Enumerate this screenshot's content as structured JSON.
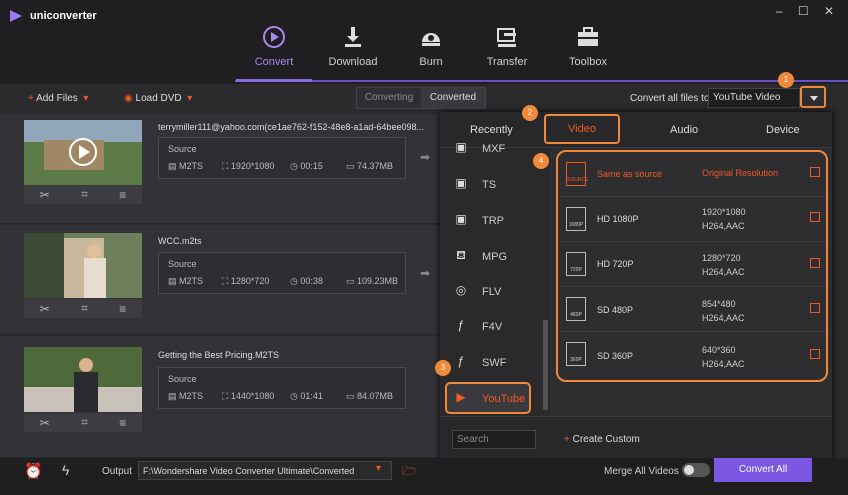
{
  "app": {
    "title": "uniconverter",
    "window_controls": "‒ ☐ ✕"
  },
  "nav": {
    "items": [
      {
        "label": "Convert",
        "icon": "convert-icon"
      },
      {
        "label": "Download",
        "icon": "download-icon"
      },
      {
        "label": "Burn",
        "icon": "burn-icon"
      },
      {
        "label": "Transfer",
        "icon": "transfer-icon"
      },
      {
        "label": "Toolbox",
        "icon": "toolbox-icon"
      }
    ]
  },
  "toolbar": {
    "add_files": "Add Files",
    "load_dvd": "Load DVD",
    "converting": "Converting",
    "converted": "Converted",
    "convert_all_label": "Convert all files to:",
    "convert_all_value": "YouTube Video"
  },
  "files": [
    {
      "name": "terrymiller111@yahoo.com(ce1ae762-f152-48e8-a1ad-64bee098...",
      "source": "Source",
      "format": "M2TS",
      "resolution": "1920*1080",
      "duration": "00:15",
      "size": "74.37MB"
    },
    {
      "name": "WCC.m2ts",
      "source": "Source",
      "format": "M2TS",
      "resolution": "1280*720",
      "duration": "00:38",
      "size": "109.23MB"
    },
    {
      "name": "Getting the Best Pricing.M2TS",
      "source": "Source",
      "format": "M2TS",
      "resolution": "1440*1080",
      "duration": "01:41",
      "size": "84.07MB"
    }
  ],
  "panel": {
    "tabs": [
      "Recently",
      "Video",
      "Audio",
      "Device"
    ],
    "formats": [
      "MXF",
      "TS",
      "TRP",
      "MPG",
      "FLV",
      "F4V",
      "SWF",
      "YouTube"
    ],
    "resolutions": [
      {
        "name": "Same as source",
        "desc1": "Original Resolution",
        "desc2": "",
        "icon_label": "SOURCE"
      },
      {
        "name": "HD 1080P",
        "desc1": "1920*1080",
        "desc2": "H264,AAC",
        "icon_label": "1080P"
      },
      {
        "name": "HD 720P",
        "desc1": "1280*720",
        "desc2": "H264,AAC",
        "icon_label": "720P"
      },
      {
        "name": "SD 480P",
        "desc1": "854*480",
        "desc2": "H264,AAC",
        "icon_label": "480P"
      },
      {
        "name": "SD 360P",
        "desc1": "640*360",
        "desc2": "H264,AAC",
        "icon_label": "360P"
      }
    ],
    "search_placeholder": "Search",
    "create_custom": "Create Custom"
  },
  "badges": [
    "1",
    "2",
    "3",
    "4"
  ],
  "bottom": {
    "output_label": "Output",
    "output_path": "F:\\Wondershare Video Converter Ultimate\\Converted",
    "merge_label": "Merge All Videos",
    "convert_all": "Convert All"
  },
  "colors": {
    "accent": "#7b57e4",
    "highlight": "#f08a3a",
    "orange_text": "#f05a28"
  }
}
